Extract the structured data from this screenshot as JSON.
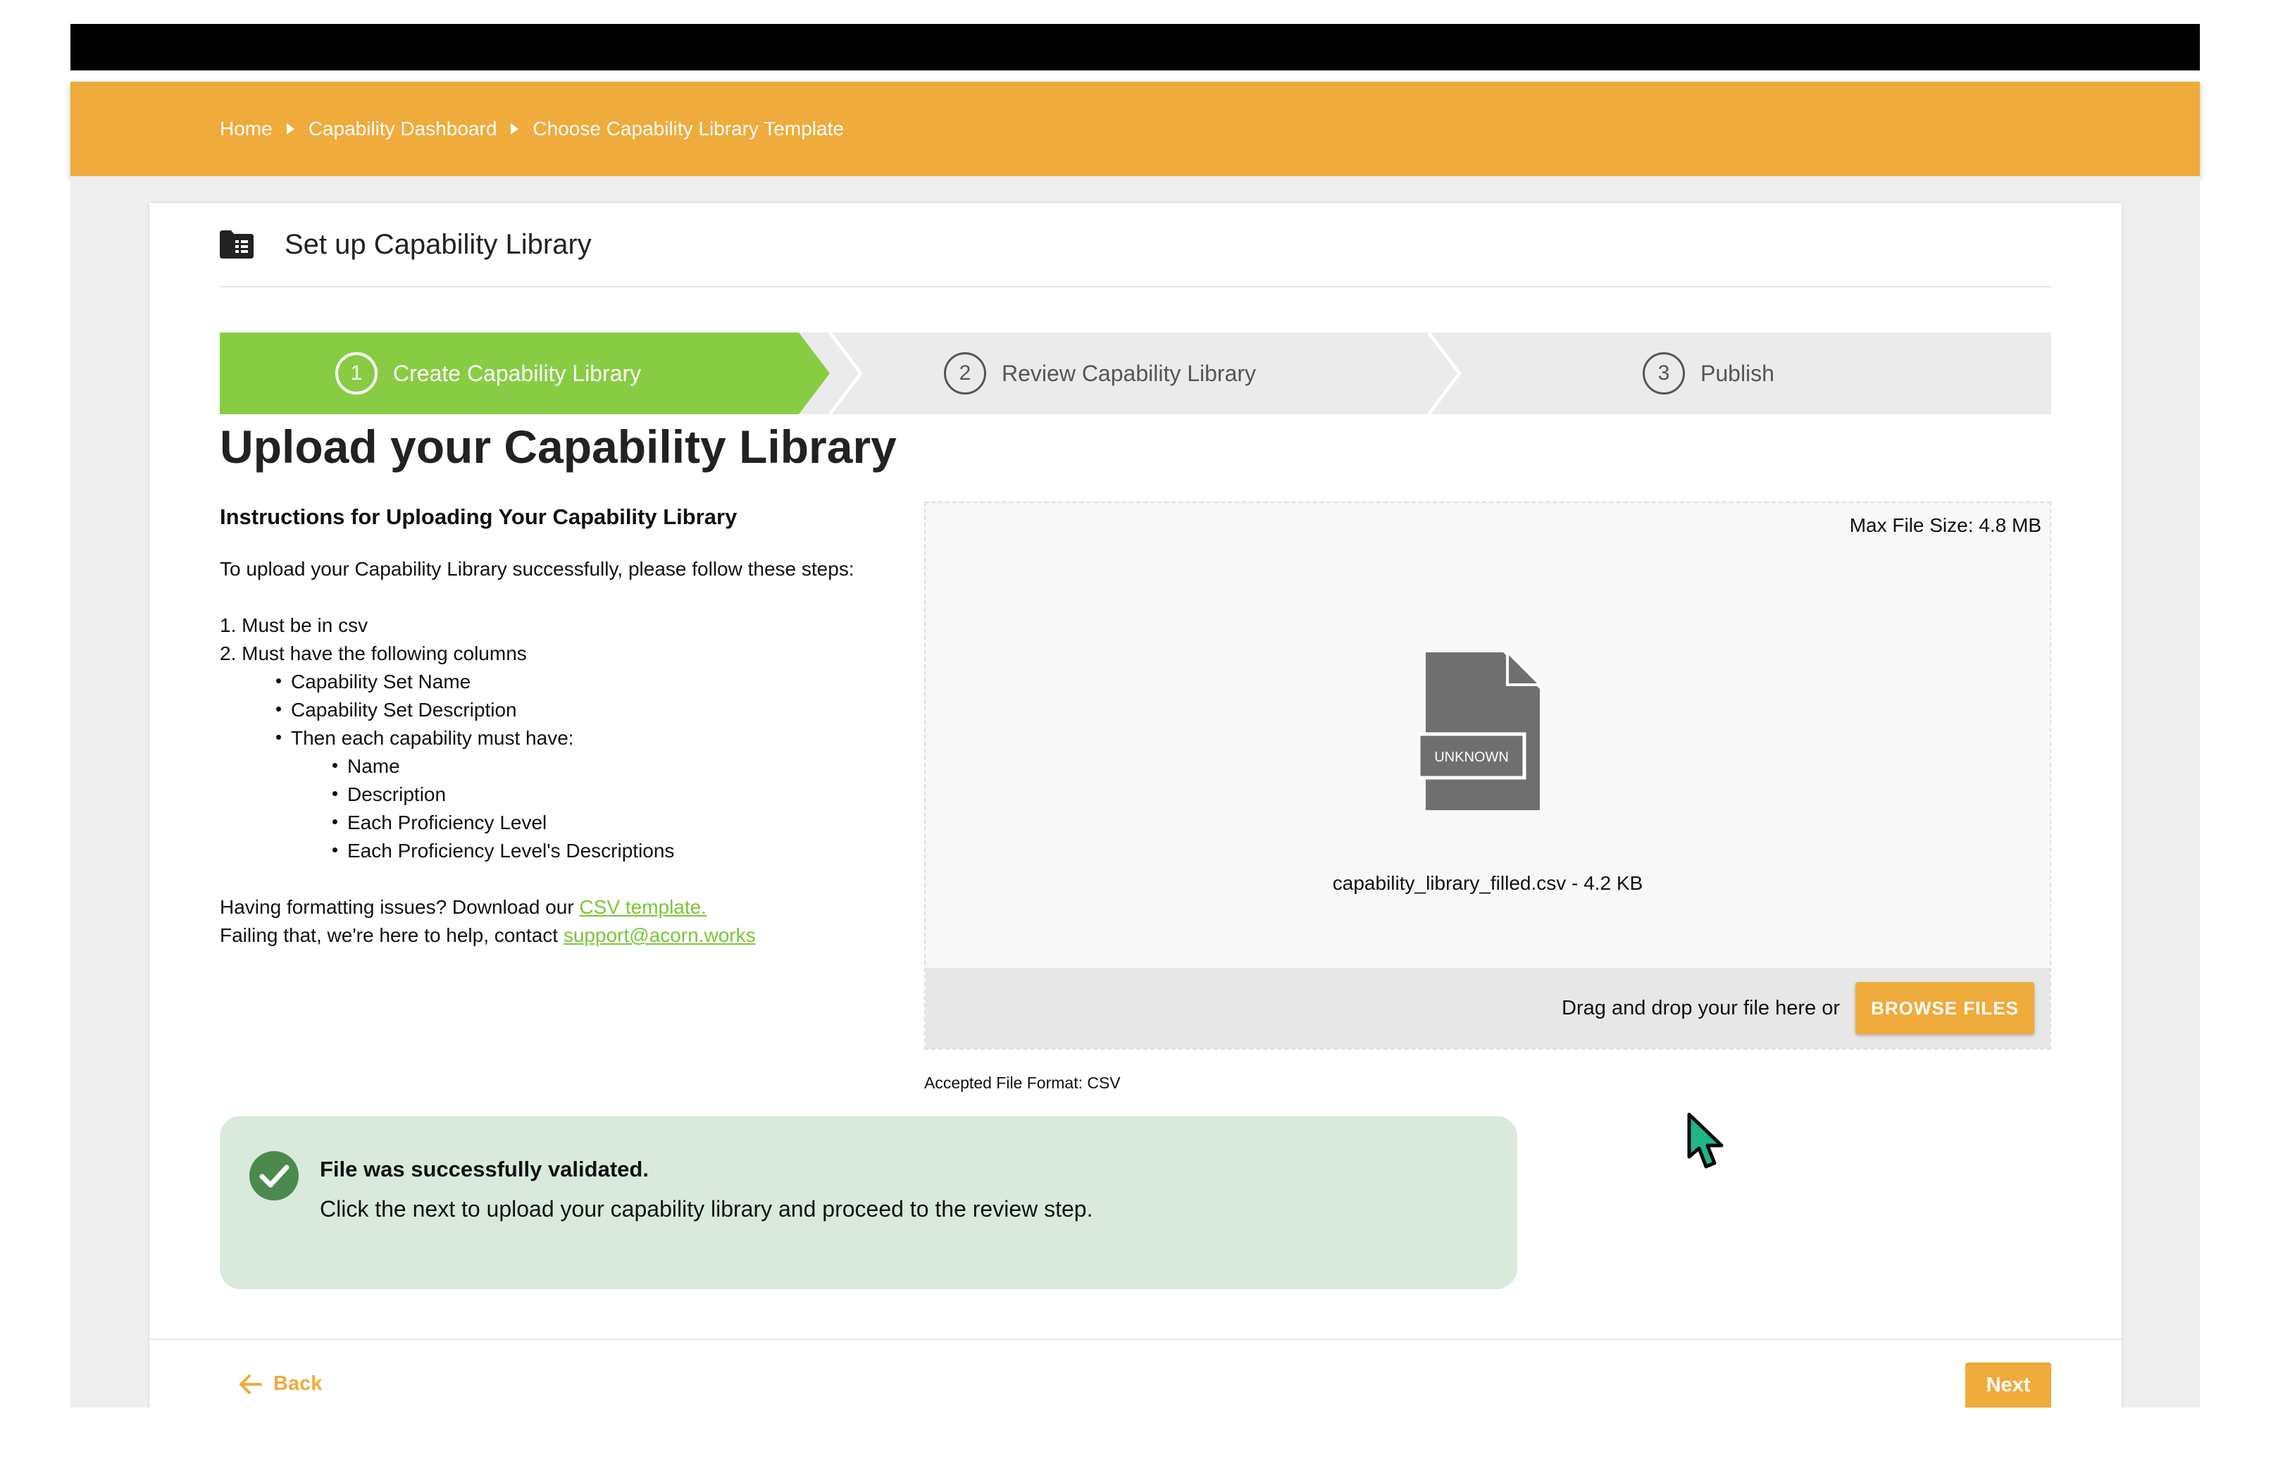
{
  "breadcrumb": {
    "items": [
      "Home",
      "Capability Dashboard",
      "Choose Capability Library Template"
    ]
  },
  "card": {
    "title": "Set up Capability Library",
    "icon": "folder-grid-icon"
  },
  "stepper": {
    "steps": [
      {
        "number": "1",
        "label": "Create Capability Library",
        "active": true
      },
      {
        "number": "2",
        "label": "Review Capability Library",
        "active": false
      },
      {
        "number": "3",
        "label": "Publish",
        "active": false
      }
    ],
    "active_color": "#88cc44",
    "inactive_color": "#ebebeb"
  },
  "main": {
    "title": "Upload your Capability Library"
  },
  "instructions": {
    "heading": "Instructions for Uploading Your Capability Library",
    "intro": "To upload your Capability Library successfully, please follow these steps:",
    "step1": "1. Must be in csv",
    "step2": "2. Must have the following columns",
    "columns": [
      "Capability Set Name",
      "Capability Set Description",
      "Then each capability must have:"
    ],
    "capability_fields": [
      "Name",
      "Description",
      "Each Proficiency Level",
      "Each Proficiency Level's Descriptions"
    ],
    "template_text": "Having formatting issues? Download our ",
    "template_link": "CSV template.",
    "contact_text": "Failing that, we're here to help, contact ",
    "contact_link": "support@acorn.works"
  },
  "dropzone": {
    "max_size": "Max File Size: 4.8 MB",
    "file_badge": "UNKNOWN",
    "file_name": "capability_library_filled.csv - 4.2 KB",
    "drop_text": "Drag and drop your file here or",
    "browse_label": "BROWSE FILES",
    "accepted": "Accepted File Format: CSV"
  },
  "alert": {
    "title": "File was successfully validated.",
    "message": "Click the next to upload your capability library and proceed to the review step.",
    "icon": "check-circle-icon"
  },
  "footer": {
    "back_label": "Back",
    "next_label": "Next"
  },
  "colors": {
    "accent": "#efab3c",
    "success_bg": "#d9e9dc",
    "success_icon": "#4a8a4f",
    "link": "#7ac63a"
  }
}
